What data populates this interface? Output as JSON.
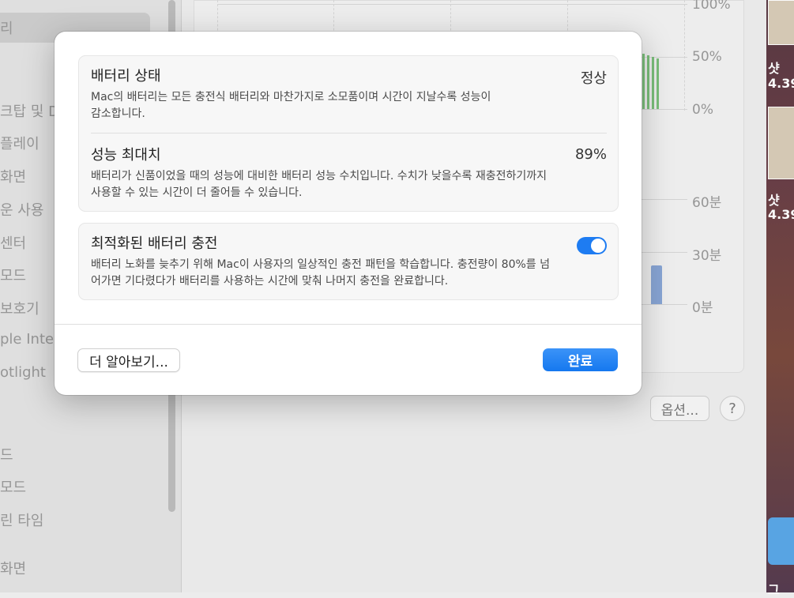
{
  "background": {
    "sidebar": {
      "items": [
        {
          "label": "리"
        },
        {
          "label": "크탑 및 D"
        },
        {
          "label": "플레이"
        },
        {
          "label": "화면"
        },
        {
          "label": "운 사용"
        },
        {
          "label": "센터"
        },
        {
          "label": "모드"
        },
        {
          "label": "보호기"
        },
        {
          "label": "ple Intelli"
        },
        {
          "label": "otlight"
        },
        {
          "label": "드"
        },
        {
          "label": "모드"
        },
        {
          "label": "린 타임"
        },
        {
          "label": "화면"
        }
      ]
    },
    "chart_top": {
      "ticks": [
        "100%",
        "50%",
        "0%"
      ]
    },
    "chart_bottom": {
      "ticks": [
        "60분",
        "30분",
        "0분"
      ]
    },
    "options_button": "옵션...",
    "help_button": "?",
    "desktop": {
      "label1": "샷",
      "label1b": "4.39",
      "label2": "샷",
      "label2b": "4.39",
      "label3": "그"
    }
  },
  "dialog": {
    "battery_status": {
      "title": "배터리 상태",
      "value": "정상",
      "description": "Mac의 배터리는 모든 충전식 배터리와 마찬가지로 소모품이며 시간이 지날수록 성능이 감소합니다."
    },
    "max_capacity": {
      "title": "성능 최대치",
      "value": "89%",
      "description": "배터리가 신품이었을 때의 성능에 대비한 배터리 성능 수치입니다. 수치가 낮을수록 재충전하기까지 사용할 수 있는 시간이 더 줄어들 수 있습니다."
    },
    "optimized_charging": {
      "title": "최적화된 배터리 충전",
      "enabled": true,
      "description": "배터리 노화를 늦추기 위해 Mac이 사용자의 일상적인 충전 패턴을 학습합니다. 충전량이 80%를 넘어가면 기다렸다가 배터리를 사용하는 시간에 맞춰 나머지 충전을 완료합니다."
    },
    "learn_more_button": "더 알아보기...",
    "done_button": "완료"
  }
}
